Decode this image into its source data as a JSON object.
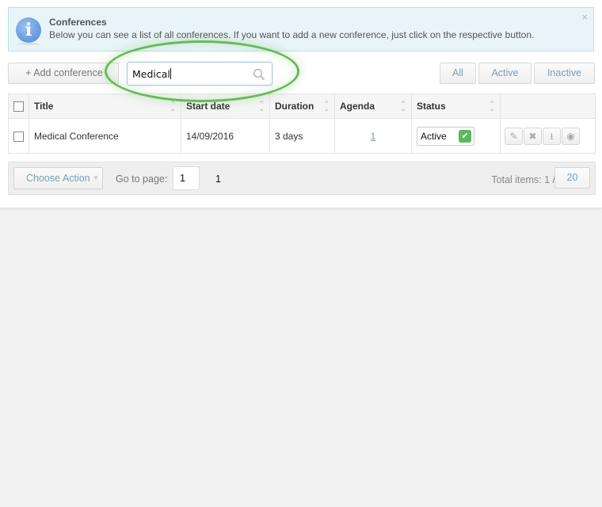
{
  "info": {
    "title": "Conferences",
    "text": "Below you can see a list of all conferences. If you want to add a new conference, just click on the respective button.",
    "close": "×",
    "icon": "info-icon"
  },
  "toolbar": {
    "add_label": "+ Add conference",
    "search_value": "Medical",
    "filters": [
      "All",
      "Active",
      "Inactive"
    ]
  },
  "table": {
    "columns": [
      "Title",
      "Start date",
      "Duration",
      "Agenda",
      "Status",
      ""
    ],
    "rows": [
      {
        "title": "Medical Conference",
        "start_date": "14/09/2016",
        "duration": "3 days",
        "agenda": "1",
        "status": "Active",
        "actions": [
          "edit-icon",
          "delete-icon",
          "download-icon",
          "view-icon"
        ]
      }
    ]
  },
  "footer": {
    "choose_action": "Choose Action",
    "goto_label": "Go to page:",
    "goto_value": "1",
    "page_count": "1",
    "total_label": "Total items: 1 /",
    "per_page": "20"
  },
  "colors": {
    "accent": "#6fa4c4",
    "highlight_ellipse": "#66bb55",
    "status_active": "#5cb85c"
  }
}
